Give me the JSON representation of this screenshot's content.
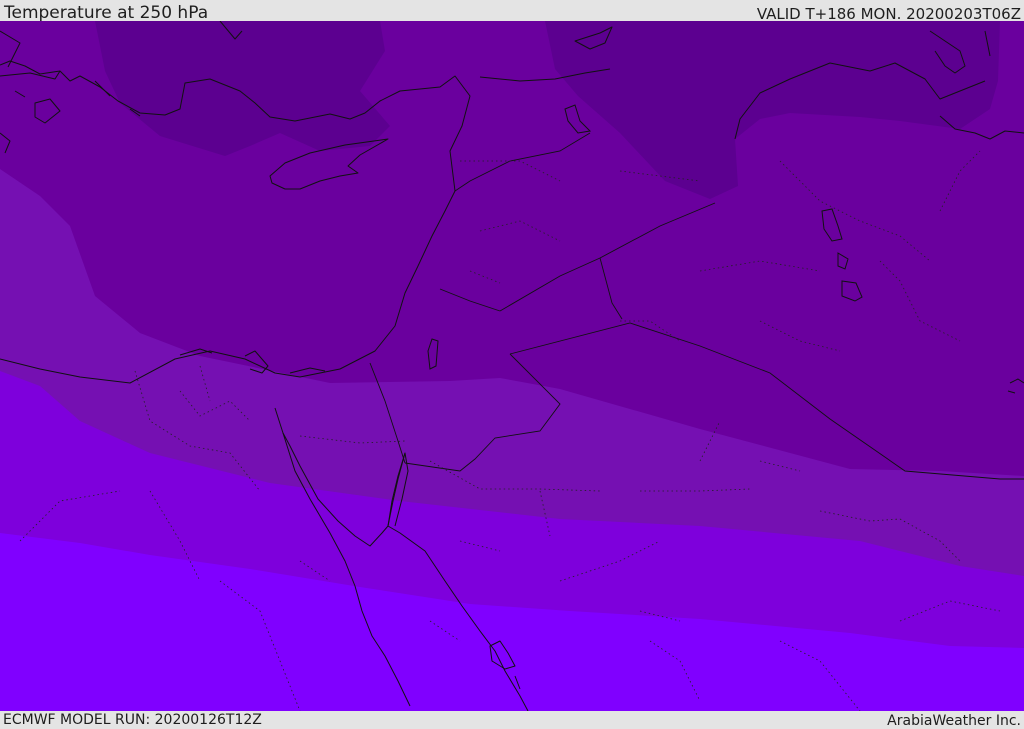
{
  "header": {
    "title": "Temperature at 250 hPa",
    "valid": "VALID T+186 MON. 20200203T06Z"
  },
  "footer": {
    "model_run": "ECMWF MODEL RUN: 20200126T12Z",
    "credit": "ArabiaWeather Inc."
  },
  "colors": {
    "band_coldest": "#5c0090",
    "band_cold": "#6a009e",
    "band_mid": "#7510b2",
    "band_warm": "#7e00dc",
    "band_warmest": "#8000ff"
  }
}
